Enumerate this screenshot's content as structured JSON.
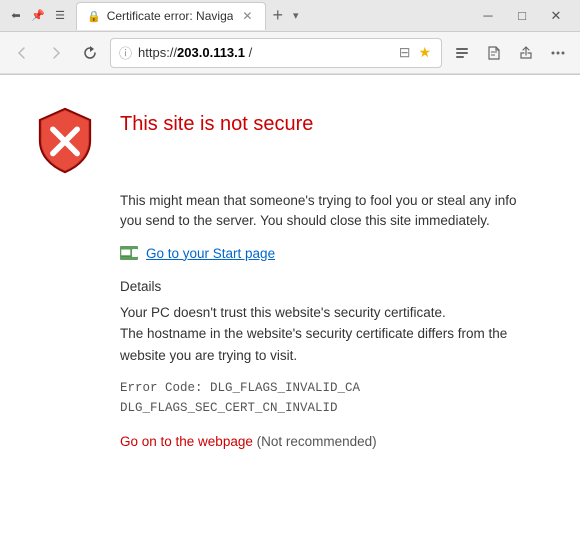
{
  "window": {
    "title": "Certificate error: Naviga",
    "tab_label": "Certificate error: Naviga",
    "close_label": "✕",
    "minimize_label": "─",
    "maximize_label": "□"
  },
  "address_bar": {
    "back_icon": "←",
    "forward_icon": "→",
    "refresh_icon": "↻",
    "url_prefix": "https://",
    "url_host": "203.0.113.1",
    "url_suffix": " /",
    "reader_icon": "📖",
    "favorites_icon": "☆",
    "hub_icon": "☆",
    "notes_icon": "✏",
    "share_icon": "↗",
    "more_icon": "•••"
  },
  "error": {
    "title": "This site is not secure",
    "description": "This might mean that someone's trying to fool you or steal any info you send to the server. You should close this site immediately.",
    "start_page_link": "Go to your Start page",
    "details_heading": "Details",
    "details_line1": "Your PC doesn't trust this website's security certificate.",
    "details_line2": "The hostname in the website's security certificate differs from the website you are trying to visit.",
    "error_code_line1": "Error Code:  DLG_FLAGS_INVALID_CA",
    "error_code_line2": "DLG_FLAGS_SEC_CERT_CN_INVALID",
    "go_on_link": "Go on to the webpage",
    "not_recommended": "(Not recommended)"
  }
}
